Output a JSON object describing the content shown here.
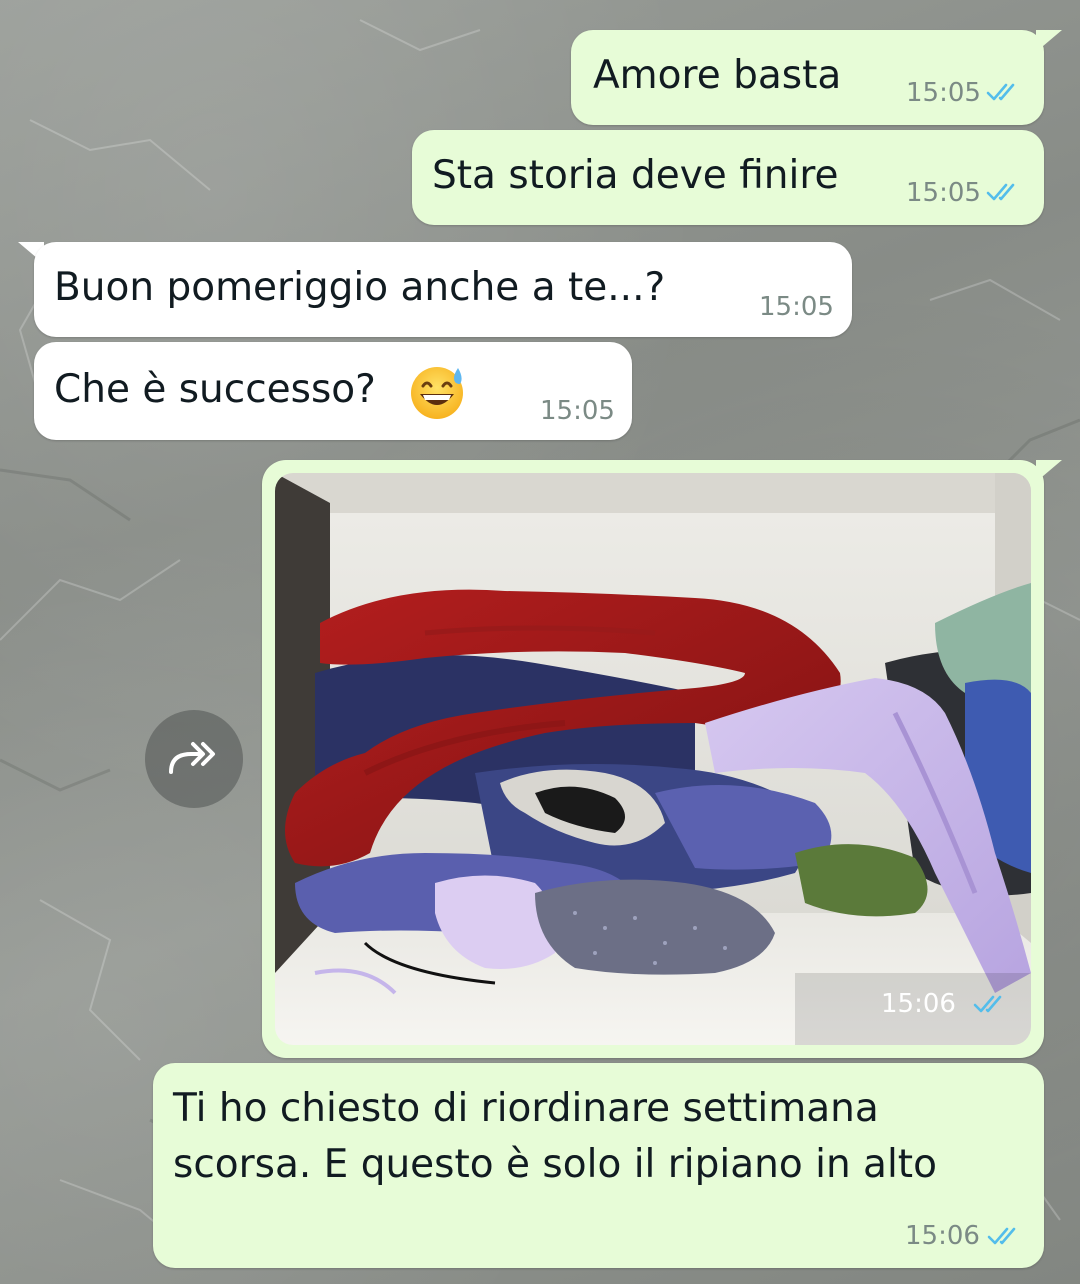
{
  "messages": [
    {
      "direction": "outgoing",
      "text": "Amore basta",
      "time": "15:05",
      "status": "read"
    },
    {
      "direction": "outgoing",
      "text": "Sta storia deve finire",
      "time": "15:05",
      "status": "read"
    },
    {
      "direction": "incoming",
      "text": "Buon pomeriggio anche a te...?",
      "time": "15:05"
    },
    {
      "direction": "incoming",
      "text": "Che è successo?",
      "emoji": "grinning-face-with-sweat",
      "time": "15:05"
    },
    {
      "direction": "outgoing",
      "type": "image",
      "image_description": "shelf with pile of clothes",
      "time": "15:06",
      "status": "read"
    },
    {
      "direction": "outgoing",
      "lines": [
        "Ti ho chiesto di riordinare settimana",
        "scorsa. E questo è solo il ripiano in alto"
      ],
      "time": "15:06",
      "status": "read"
    }
  ],
  "icons": {
    "forward": "forward-icon",
    "read_receipt": "double-check-icon"
  },
  "colors": {
    "outgoing_bubble": "#e7fcd7",
    "incoming_bubble": "#ffffff",
    "read_ticks": "#53bdeb",
    "text": "#111b21",
    "timestamp": "#7b8a85"
  }
}
